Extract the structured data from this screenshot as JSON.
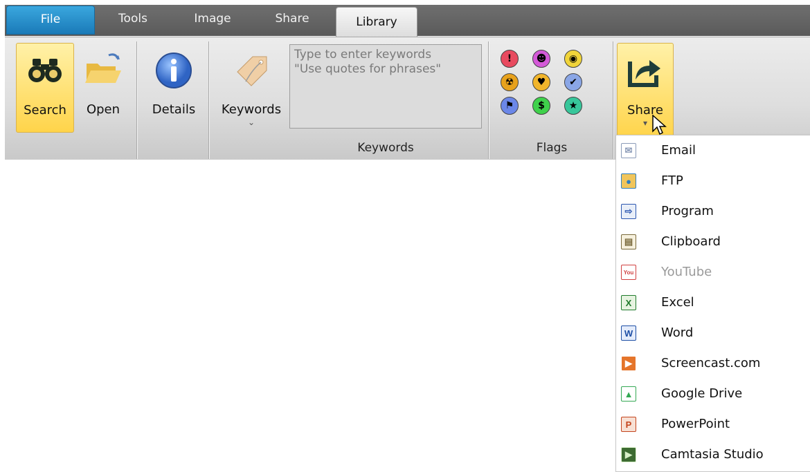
{
  "tabs": [
    "File",
    "Tools",
    "Image",
    "Share",
    "Library"
  ],
  "ribbon": {
    "search_label": "Search",
    "open_label": "Open",
    "details_label": "Details",
    "keywords_label": "Keywords",
    "keywords_dropdown": "⌄",
    "keywords_placeholder_line1": "Type to enter keywords",
    "keywords_placeholder_line2": "\"Use quotes for phrases\"",
    "group_keywords": "Keywords",
    "group_flags": "Flags",
    "share_label": "Share",
    "share_dropdown": "▾"
  },
  "flags": [
    {
      "name": "exclamation-flag-icon",
      "glyph": "!",
      "color": "#e84a5f"
    },
    {
      "name": "smiley-flag-icon",
      "glyph": "☻",
      "color": "#d45ad8"
    },
    {
      "name": "lightbulb-flag-icon",
      "glyph": "◉",
      "color": "#f0d43a"
    },
    {
      "name": "radioactive-flag-icon",
      "glyph": "☢",
      "color": "#e8a21c"
    },
    {
      "name": "heart-flag-icon",
      "glyph": "♥",
      "color": "#f1b52b"
    },
    {
      "name": "check-flag-icon",
      "glyph": "✔",
      "color": "#8aa6e6"
    },
    {
      "name": "flag-flag-icon",
      "glyph": "⚑",
      "color": "#6b87e8"
    },
    {
      "name": "dollar-flag-icon",
      "glyph": "$",
      "color": "#3fd14b"
    },
    {
      "name": "star-flag-icon",
      "glyph": "★",
      "color": "#37c69a"
    }
  ],
  "share_menu": [
    {
      "name": "email",
      "label": "Email",
      "icon": "email-icon",
      "glyph": "✉",
      "bg": "#ffffff",
      "fg": "#8b9bb8",
      "disabled": false
    },
    {
      "name": "ftp",
      "label": "FTP",
      "icon": "globe-icon",
      "glyph": "●",
      "bg": "#f1c55a",
      "fg": "#2f7fbf",
      "disabled": false
    },
    {
      "name": "program",
      "label": "Program",
      "icon": "program-icon",
      "glyph": "⇨",
      "bg": "#e8eef8",
      "fg": "#2b56b0",
      "disabled": false
    },
    {
      "name": "clipboard",
      "label": "Clipboard",
      "icon": "clipboard-icon",
      "glyph": "▤",
      "bg": "#f6f0dd",
      "fg": "#7a6a3d",
      "disabled": false
    },
    {
      "name": "youtube",
      "label": "YouTube",
      "icon": "youtube-icon",
      "glyph": "You",
      "bg": "#ffffff",
      "fg": "#d04040",
      "disabled": true
    },
    {
      "name": "excel",
      "label": "Excel",
      "icon": "excel-icon",
      "glyph": "X",
      "bg": "#e6f3e0",
      "fg": "#1f7a2b",
      "disabled": false
    },
    {
      "name": "word",
      "label": "Word",
      "icon": "word-icon",
      "glyph": "W",
      "bg": "#e4ecfb",
      "fg": "#1e4fa5",
      "disabled": false
    },
    {
      "name": "screencast",
      "label": "Screencast.com",
      "icon": "screencast-icon",
      "glyph": "▶",
      "bg": "#e5752b",
      "fg": "#ffffff",
      "disabled": false
    },
    {
      "name": "google-drive",
      "label": "Google Drive",
      "icon": "google-drive-icon",
      "glyph": "▲",
      "bg": "#ffffff",
      "fg": "#34a853",
      "disabled": false
    },
    {
      "name": "powerpoint",
      "label": "PowerPoint",
      "icon": "powerpoint-icon",
      "glyph": "P",
      "bg": "#f7e0d4",
      "fg": "#c4441d",
      "disabled": false
    },
    {
      "name": "camtasia",
      "label": "Camtasia Studio",
      "icon": "camtasia-icon",
      "glyph": "▶",
      "bg": "#3d6b32",
      "fg": "#d8f0c8",
      "disabled": false
    }
  ]
}
